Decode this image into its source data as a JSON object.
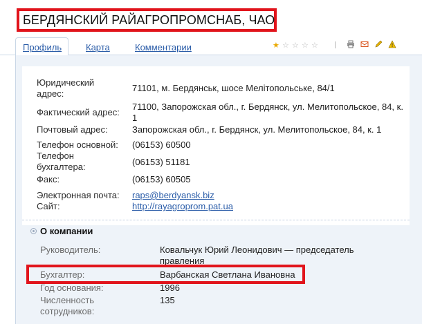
{
  "company": {
    "title": "БЕРДЯНСКИЙ РАЙАГРОПРОМСНАБ, ЧАО"
  },
  "tabs": [
    "Профиль",
    "Карта",
    "Комментарии"
  ],
  "rating": {
    "value": 1,
    "max": 5
  },
  "toolbar": {
    "print_icon": "printer-icon",
    "mail_icon": "mail-icon",
    "edit_icon": "pencil-icon",
    "warn_icon": "warning-icon"
  },
  "contacts": [
    {
      "label_lines": [
        "Юридический",
        "адрес:"
      ],
      "value_lines": [
        "71101, м. Бердянськ, шосе Мелітопольське, 84/1"
      ]
    },
    {
      "label_lines": [
        "Фактический адрес:"
      ],
      "value_lines": [
        "71100, Запорожская обл., г. Бердянск, ул. Мелитопольское, 84, к.",
        "1"
      ]
    },
    {
      "label_lines": [
        "Почтовый адрес:"
      ],
      "value_lines": [
        "Запорожская обл., г. Бердянск, ул. Мелитопольское, 84, к. 1"
      ]
    },
    {
      "label_lines": [
        "Телефон основной:"
      ],
      "value_lines": [
        "(06153) 60500"
      ]
    },
    {
      "label_lines": [
        "Телефон",
        "бухгалтера:"
      ],
      "value_lines": [
        "(06153) 51181"
      ]
    },
    {
      "label_lines": [
        "Факс:"
      ],
      "value_lines": [
        "(06153) 60505"
      ]
    },
    {
      "label_lines": [
        "Электронная почта:"
      ],
      "value_lines": [
        "raps@berdyansk.biz"
      ]
    },
    {
      "label_lines": [
        "Сайт:"
      ],
      "value_lines": [
        "http://rayagroprom.pat.ua"
      ]
    }
  ],
  "about": {
    "title": "О компании",
    "rows": [
      {
        "label_lines": [
          "Руководитель:"
        ],
        "value_lines": [
          "Ковальчук Юрий Леонидович — председатель",
          "правления"
        ]
      },
      {
        "label_lines": [
          "Бухгалтер:"
        ],
        "value_lines": [
          "Варбанская Светлана Ивановна"
        ]
      },
      {
        "label_lines": [
          "Год основания:"
        ],
        "value_lines": [
          "1996"
        ]
      },
      {
        "label_lines": [
          "Численность",
          "сотрудников:"
        ],
        "value_lines": [
          "135"
        ]
      }
    ]
  }
}
